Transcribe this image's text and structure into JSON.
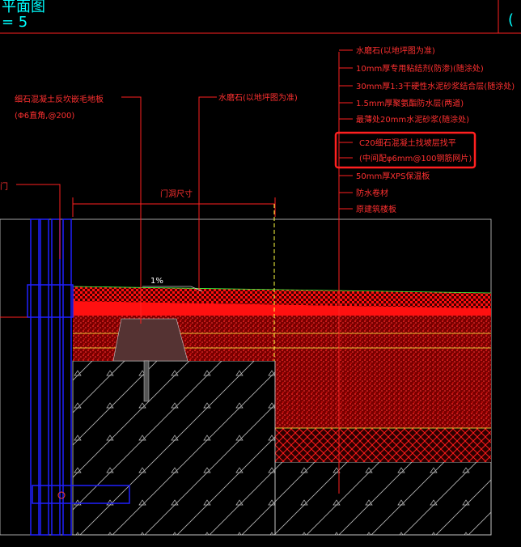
{
  "header": {
    "title_fragment": "平面图",
    "scale_fragment": "= 5",
    "corner_fragment": "("
  },
  "labels": {
    "left_note_line1": "细石混凝土反坎嵌毛地板",
    "left_note_line2": "(Φ6直角,@200)",
    "door_label": "门",
    "mid_note": "水磨石(以地坪图为准)",
    "door_dim": "门洞尺寸",
    "slope": "1%"
  },
  "layers": [
    "水磨石(以地坪图为准)",
    "10mm厚专用粘结剂(防渗)(随涂处)",
    "30mm厚1:3干硬性水泥砂浆结合层(随涂处)",
    "1.5mm厚聚氨酯防水层(两道)",
    "最薄处20mm水泥砂浆(随涂处)",
    "C20细石混凝土找坡层找平",
    "(中间配φ6mm@100钢筋网片)",
    "50mm厚XPS保温板",
    "防水卷材",
    "原建筑楼板"
  ],
  "highlight": {
    "color": "#ff2020",
    "layer_indices": [
      5,
      6
    ]
  },
  "colors": {
    "leader": "#ff2020",
    "frame_blue": "#2020ff",
    "hatch_red": "#ff1010",
    "line_yellow": "#ffff40",
    "line_green": "#40ff40",
    "outline_white": "#cccccc"
  }
}
